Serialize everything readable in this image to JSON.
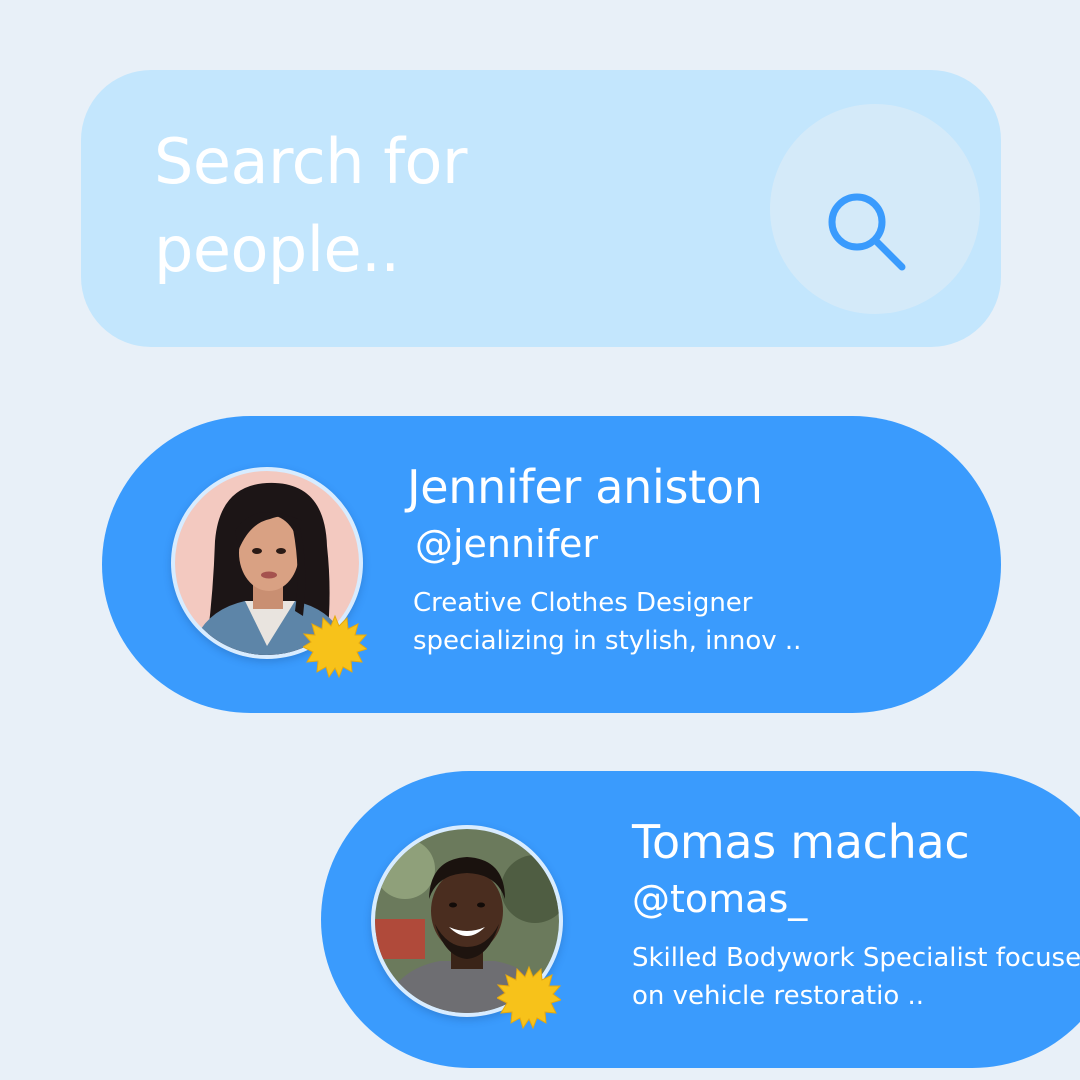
{
  "search": {
    "placeholder_line1": "Search for",
    "placeholder_line2": "people..",
    "button_icon": "search-icon",
    "button_icon_color": "#3a9bfd"
  },
  "people": [
    {
      "name": "Jennifer aniston",
      "handle": "@jennifer",
      "bio_line1": "Creative Clothes Designer",
      "bio_line2": "specializing in stylish, innov ..",
      "verified": true
    },
    {
      "name": "Tomas machac",
      "handle": "@tomas_",
      "bio_line1": "Skilled Bodywork Specialist focused",
      "bio_line2": "on vehicle restoratio ..",
      "verified": true
    }
  ],
  "colors": {
    "background": "#e8f0f8",
    "search_bar": "#c3e6fd",
    "card": "#3a9bfd",
    "badge": "#f7c21a"
  }
}
